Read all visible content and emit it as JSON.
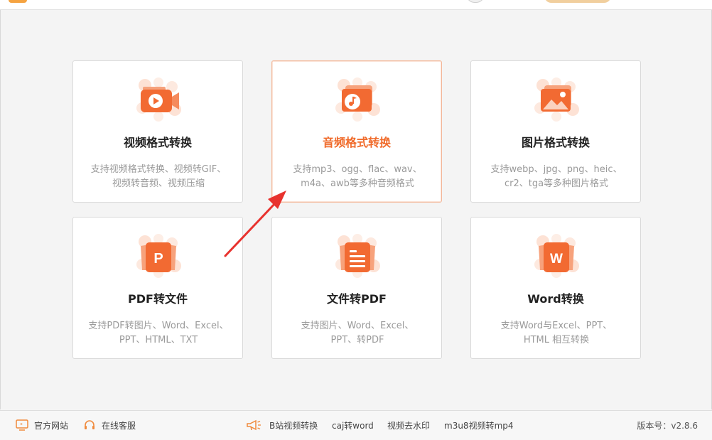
{
  "cards": [
    {
      "title": "视频格式转换",
      "desc": [
        "支持视频格式转换、视频转GIF、",
        "视频转音频、视频压缩"
      ],
      "icon": "video-icon"
    },
    {
      "title": "音频格式转换",
      "desc": [
        "支持mp3、ogg、flac、wav、",
        "m4a、awb等多种音频格式"
      ],
      "icon": "audio-icon",
      "active": true
    },
    {
      "title": "图片格式转换",
      "desc": [
        "支持webp、jpg、png、heic、",
        "cr2、tga等多种图片格式"
      ],
      "icon": "image-icon"
    },
    {
      "title": "PDF转文件",
      "desc": [
        "支持PDF转图片、Word、Excel、",
        "PPT、HTML、TXT"
      ],
      "icon": "pdf-icon",
      "glyph": "P"
    },
    {
      "title": "文件转PDF",
      "desc": [
        "支持图片、Word、Excel、",
        "PPT、转PDF"
      ],
      "icon": "document-icon"
    },
    {
      "title": "Word转换",
      "desc": [
        "支持Word与Excel、PPT、",
        "HTML 相互转换"
      ],
      "icon": "word-icon",
      "glyph": "W"
    }
  ],
  "footer": {
    "website": "官方网站",
    "support": "在线客服",
    "links": [
      "B站视频转换",
      "caj转word",
      "视频去水印",
      "m3u8视频转mp4"
    ],
    "version": "版本号：v2.8.6"
  },
  "colors": {
    "accent": "#f06b2b",
    "icon_light": "#fbcfb8",
    "icon_dark": "#f0612b"
  }
}
